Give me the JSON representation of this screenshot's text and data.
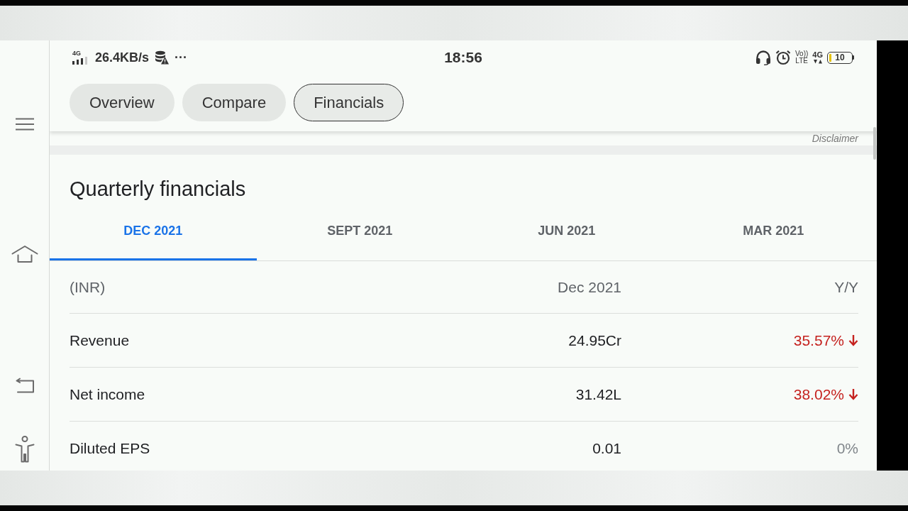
{
  "status_bar": {
    "network_type": "4G",
    "speed": "26.4KB/s",
    "more": "···",
    "time": "18:56",
    "volte_top": "Vo))",
    "volte_bottom": "LTE",
    "data_type": "4G",
    "battery": "10"
  },
  "nav_tabs": [
    {
      "label": "Overview",
      "selected": false
    },
    {
      "label": "Compare",
      "selected": false
    },
    {
      "label": "Financials",
      "selected": true
    }
  ],
  "disclaimer": "Disclaimer",
  "quarterly": {
    "title": "Quarterly financials",
    "periods": [
      {
        "label": "DEC 2021",
        "selected": true
      },
      {
        "label": "SEPT 2021",
        "selected": false
      },
      {
        "label": "JUN 2021",
        "selected": false
      },
      {
        "label": "MAR 2021",
        "selected": false
      }
    ],
    "table": {
      "columns": [
        "(INR)",
        "Dec 2021",
        "Y/Y"
      ],
      "rows": [
        {
          "label": "Revenue",
          "value": "24.95Cr",
          "change": "35.57%",
          "kind": "decrease"
        },
        {
          "label": "Net income",
          "value": "31.42L",
          "change": "38.02%",
          "kind": "decrease"
        },
        {
          "label": "Diluted EPS",
          "value": "0.01",
          "change": "0%",
          "kind": "unchanged"
        }
      ]
    }
  }
}
